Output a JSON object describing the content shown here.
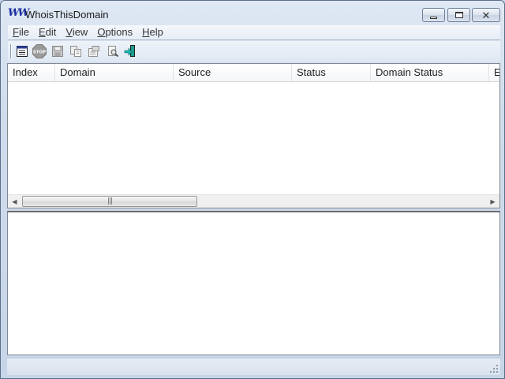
{
  "window": {
    "title": "WhoisThisDomain",
    "icon_glyph": "W"
  },
  "caption_buttons": [
    "minimize-icon",
    "maximize-icon",
    "close-icon"
  ],
  "menu": {
    "items": [
      {
        "accel": "F",
        "rest": "ile"
      },
      {
        "accel": "E",
        "rest": "dit"
      },
      {
        "accel": "V",
        "rest": "iew"
      },
      {
        "accel": "O",
        "rest": "ptions"
      },
      {
        "accel": "H",
        "rest": "elp"
      }
    ]
  },
  "toolbar": {
    "icons": [
      "domain-list-icon",
      "stop-icon",
      "save-icon",
      "copy-icon",
      "properties-icon",
      "find-icon",
      "exit-icon"
    ],
    "stop_label": "STOP"
  },
  "list": {
    "columns": [
      "Index",
      "Domain",
      "Source",
      "Status",
      "Domain Status",
      "E"
    ]
  },
  "colors": {
    "titlebar": "#d3deed",
    "accent_icon": "#1b2f9e",
    "exit_icon": "#1a9c8f"
  }
}
